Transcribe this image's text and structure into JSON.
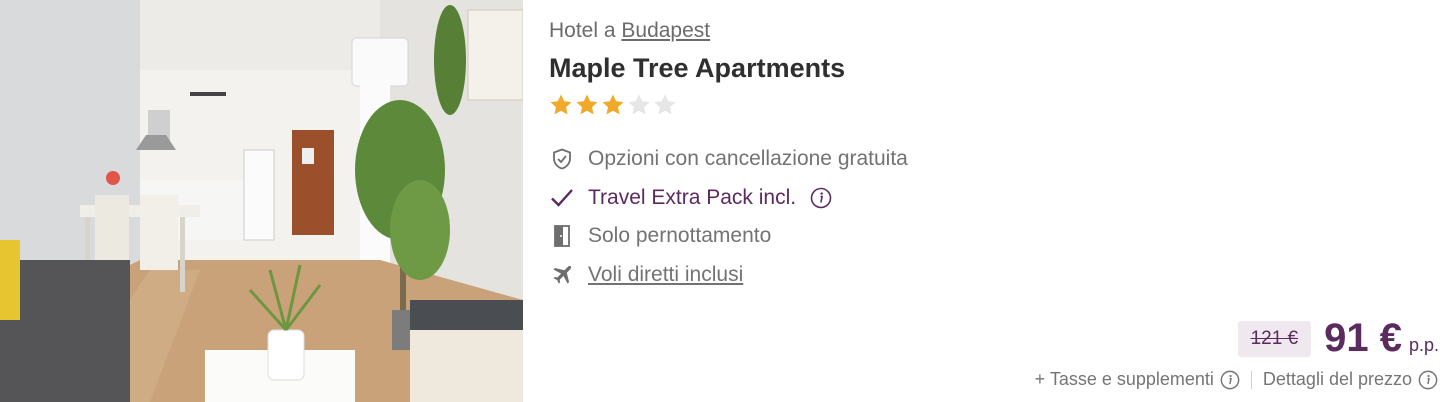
{
  "hotel": {
    "location_prefix": "Hotel a",
    "city": "Budapest",
    "name": "Maple Tree Apartments",
    "rating": 3,
    "max_rating": 5,
    "photo_alt": "Apartment living room with kitchenette"
  },
  "features": [
    {
      "icon": "shield-check-icon",
      "label": "Opzioni con cancellazione gratuita"
    },
    {
      "icon": "checkmark-icon",
      "label": "Travel Extra Pack incl."
    },
    {
      "icon": "door-icon",
      "label": "Solo pernottamento"
    },
    {
      "icon": "airplane-icon",
      "label": "Voli diretti inclusi"
    }
  ],
  "price": {
    "old": "121 €",
    "current": "91 €",
    "unit": "p.p.",
    "taxes_label": "+ Tasse e supplementi",
    "details_label": "Dettagli del prezzo"
  },
  "colors": {
    "accent": "#5b2a5e",
    "star_filled": "#f0a92b",
    "star_empty": "#e6e6e6",
    "old_price_bg": "#efe9ef"
  }
}
